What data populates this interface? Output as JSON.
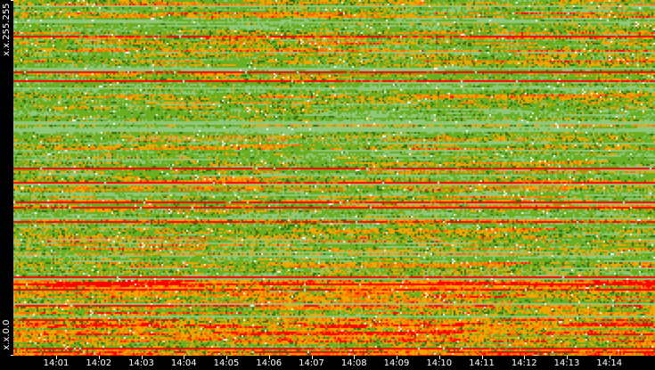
{
  "chart_data": {
    "type": "heatmap",
    "title": "",
    "ylabels": {
      "top": "x.x.255.255",
      "bottom": "x.x.0.0"
    },
    "xticks": [
      "14:01",
      "14:02",
      "14:03",
      "14:04",
      "14:05",
      "14:06",
      "14:07",
      "14:08",
      "14:09",
      "14:10",
      "14:11",
      "14:12",
      "14:13",
      "14:14"
    ],
    "color_scale": [
      "#ffffff",
      "#90c87c",
      "#6aae22",
      "#2f6e12",
      "#f0a800",
      "#ff6a00",
      "#ff0000"
    ],
    "grid": false,
    "legend": "none"
  }
}
